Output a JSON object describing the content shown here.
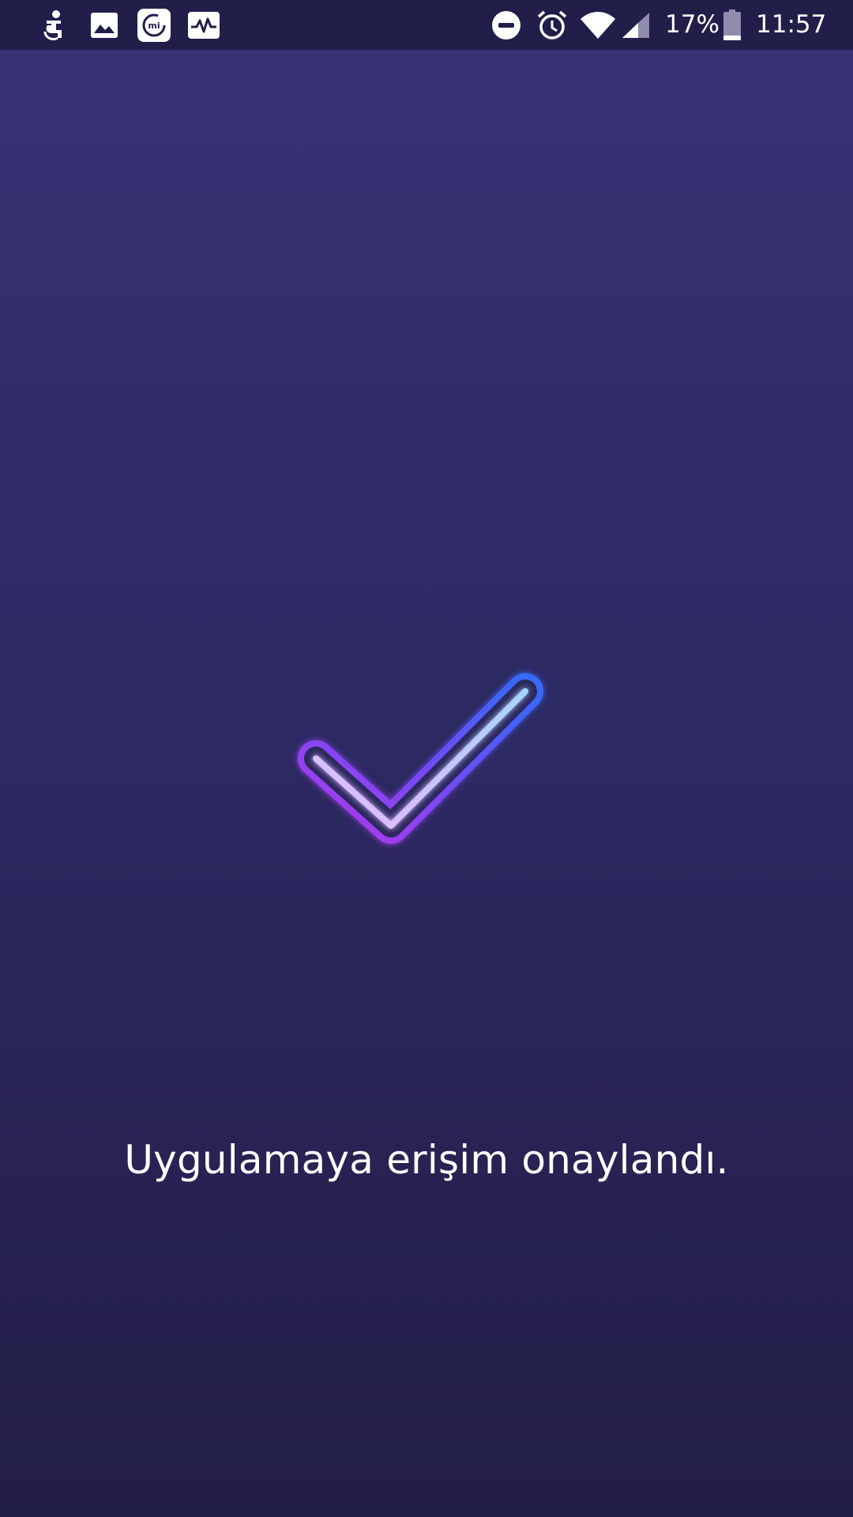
{
  "status_bar": {
    "notification_icons": [
      "accessibility-icon",
      "gallery-icon",
      "mi-fit-icon",
      "activity-icon"
    ],
    "system_icons": [
      "do-not-disturb-icon",
      "alarm-icon",
      "wifi-icon",
      "signal-icon"
    ],
    "battery_percent": "17%",
    "battery_level": 0.17,
    "time": "11:57"
  },
  "main": {
    "confirmation_icon": "checkmark-icon",
    "message": "Uygulamaya erişim onaylandı."
  },
  "colors": {
    "background_top": "#3a3478",
    "background_bottom": "#211e48",
    "status_bar": "#211f4a",
    "check_blue": "#3a6cff",
    "check_purple": "#b43cf0"
  }
}
